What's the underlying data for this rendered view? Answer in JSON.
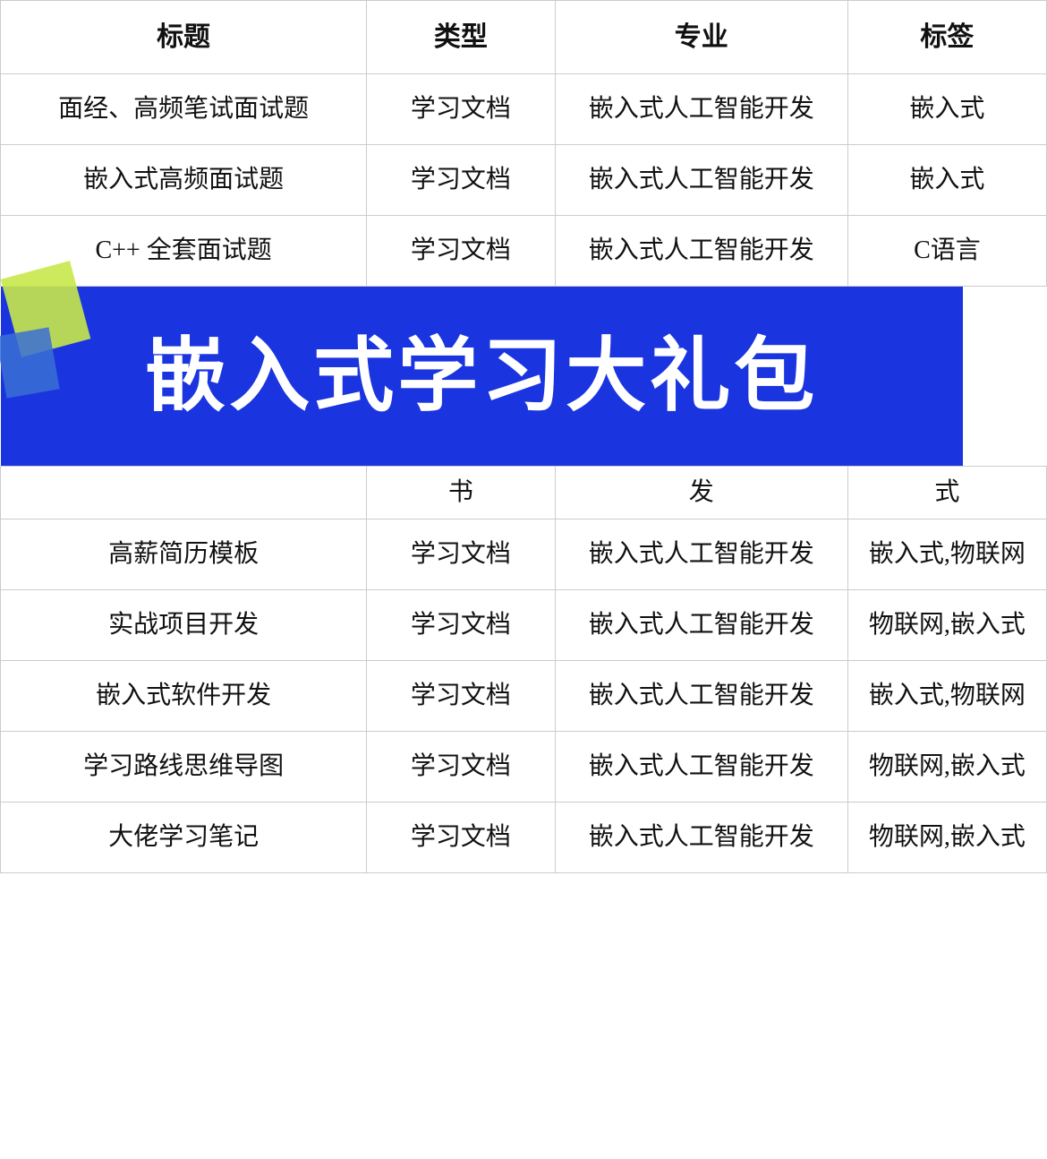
{
  "table": {
    "headers": [
      "标题",
      "类型",
      "专业",
      "标签"
    ],
    "rows": [
      {
        "title": "面经、高频笔试面试题",
        "type": "学习文档",
        "major": "嵌入式人工智能开发",
        "tag": "嵌入式"
      },
      {
        "title": "嵌入式高频面试题",
        "type": "学习文档",
        "major": "嵌入式人工智能开发",
        "tag": "嵌入式"
      },
      {
        "title": "C++ 全套面试题",
        "type": "学习文档",
        "major": "嵌入式人工智能开发",
        "tag": "C语言"
      }
    ],
    "partial_row": {
      "type": "书",
      "major": "发",
      "tag": "式"
    },
    "banner_text": "嵌入式学习大礼包",
    "rows_after": [
      {
        "title": "高薪简历模板",
        "type": "学习文档",
        "major": "嵌入式人工智能开发",
        "tag": "嵌入式,物联网"
      },
      {
        "title": "实战项目开发",
        "type": "学习文档",
        "major": "嵌入式人工智能开发",
        "tag": "物联网,嵌入式"
      },
      {
        "title": "嵌入式软件开发",
        "type": "学习文档",
        "major": "嵌入式人工智能开发",
        "tag": "嵌入式,物联网"
      },
      {
        "title": "学习路线思维导图",
        "type": "学习文档",
        "major": "嵌入式人工智能开发",
        "tag": "物联网,嵌入式"
      },
      {
        "title": "大佬学习笔记",
        "type": "学习文档",
        "major": "嵌入式人工智能开发",
        "tag": "物联网,嵌入式"
      }
    ]
  }
}
